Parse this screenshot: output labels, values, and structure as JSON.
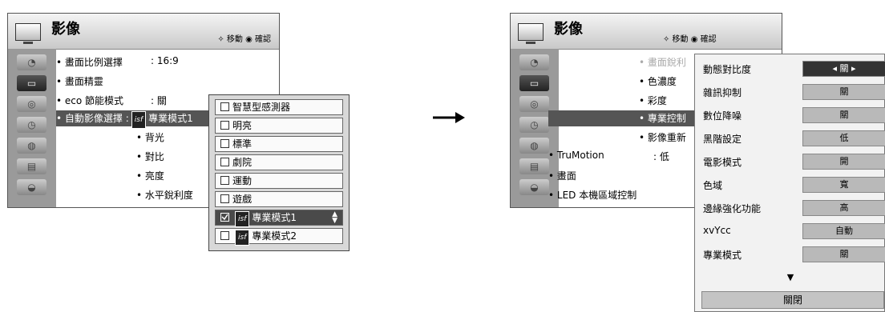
{
  "left": {
    "title": "影像",
    "nav_hint": "✧ 移動 ◉ 確認",
    "items": [
      {
        "label": "• 畫面比例選擇",
        "value": ": 16:9"
      },
      {
        "label": "• 畫面精靈",
        "value": ""
      },
      {
        "label": "• eco 節能模式",
        "value": ": 關"
      },
      {
        "label": "• 自動影像選擇 :",
        "value": "專業模式1"
      },
      {
        "label": "• 背光",
        "value": ""
      },
      {
        "label": "• 對比",
        "value": ""
      },
      {
        "label": "• 亮度",
        "value": ""
      },
      {
        "label": "• 水平銳利度",
        "value": ""
      }
    ],
    "isf_badge": "isf"
  },
  "dropdown": {
    "options": [
      "智慧型感測器",
      "明亮",
      "標準",
      "劇院",
      "運動",
      "遊戲",
      "專業模式1",
      "專業模式2"
    ],
    "selected_index": 6
  },
  "right": {
    "title": "影像",
    "nav_hint": "✧ 移動 ◉ 確認",
    "items": [
      {
        "label": "• 畫面銳利"
      },
      {
        "label": "• 色濃度"
      },
      {
        "label": "• 彩度"
      },
      {
        "label": "• 專業控制"
      },
      {
        "label": "• 影像重新"
      },
      {
        "label": "• TruMotion",
        "value": ": 低"
      },
      {
        "label": "• 畫面"
      },
      {
        "label": "• LED 本機區域控制"
      }
    ]
  },
  "settings": {
    "rows": [
      {
        "label": "動態對比度",
        "value": "◂ 關 ▸"
      },
      {
        "label": "雜訊抑制",
        "value": "關"
      },
      {
        "label": "數位降噪",
        "value": "關"
      },
      {
        "label": "黑階設定",
        "value": "低"
      },
      {
        "label": "電影模式",
        "value": "開"
      },
      {
        "label": "色域",
        "value": "寬"
      },
      {
        "label": "邊緣強化功能",
        "value": "高"
      },
      {
        "label": "xvYcc",
        "value": "自動"
      },
      {
        "label": "專業模式",
        "value": "關"
      }
    ],
    "more_indicator": "▼",
    "close_label": "關閉"
  }
}
